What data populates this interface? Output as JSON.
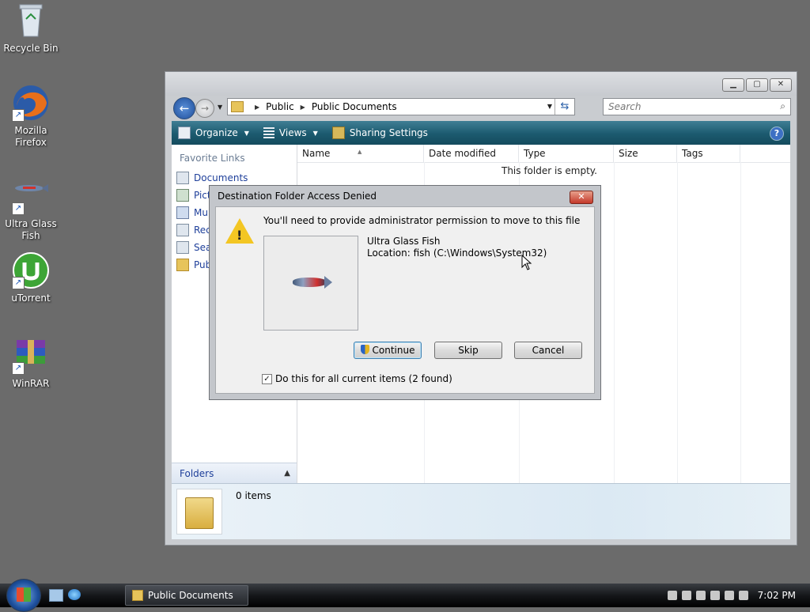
{
  "desktop": {
    "icons": [
      {
        "label": "Recycle Bin"
      },
      {
        "label": "Mozilla Firefox"
      },
      {
        "label": "Ultra Glass Fish"
      },
      {
        "label": "uTorrent"
      },
      {
        "label": "WinRAR"
      }
    ]
  },
  "explorer": {
    "breadcrumb": [
      "Public",
      "Public Documents"
    ],
    "search_placeholder": "Search",
    "toolbar": {
      "organize": "Organize",
      "views": "Views",
      "sharing": "Sharing Settings",
      "help": "?"
    },
    "favorite_links_title": "Favorite Links",
    "favorite_links": [
      "Documents",
      "Pict",
      "Mu",
      "Rec",
      "Sea",
      "Pub"
    ],
    "folders_label": "Folders",
    "columns": [
      "Name",
      "Date modified",
      "Type",
      "Size",
      "Tags"
    ],
    "empty_message": "This folder is empty.",
    "item_count": "0 items"
  },
  "dialog": {
    "title": "Destination Folder Access Denied",
    "message": "You'll need to provide administrator permission to move to this file",
    "file_name": "Ultra Glass Fish",
    "file_location": "Location: fish (C:\\Windows\\System32)",
    "buttons": {
      "continue": "Continue",
      "skip": "Skip",
      "cancel": "Cancel"
    },
    "checkbox_label": "Do this for all current items (2 found)",
    "checkbox_checked": true
  },
  "taskbar": {
    "task_title": "Public Documents",
    "clock": "7:02 PM"
  }
}
